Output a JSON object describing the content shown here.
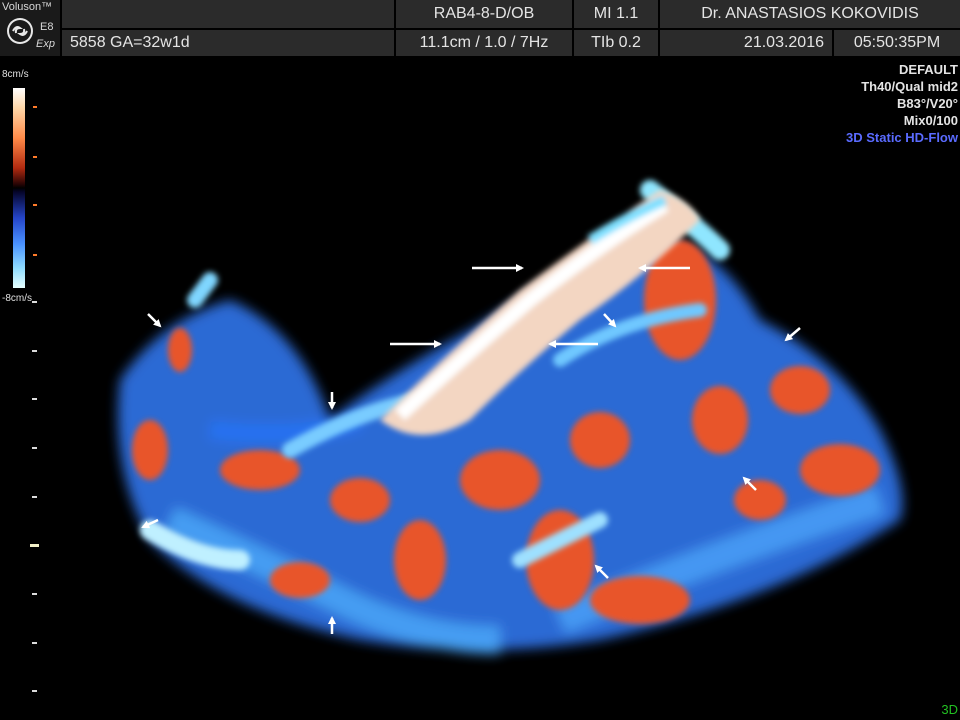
{
  "header": {
    "brand": "Voluson™",
    "model": "E8",
    "mode": "Exp",
    "probe": "RAB4-8-D/OB",
    "mi": "MI  1.1",
    "doctor": "Dr. ANASTASIOS KOKOVIDIS",
    "patient": "5858  GA=32w1d",
    "depth": "11.1cm / 1.0 /  7Hz",
    "tib": "TIb  0.2",
    "date": "21.03.2016",
    "time": "05:50:35PM"
  },
  "colorbar": {
    "top_label": "8cm/s",
    "bottom_label": "-8cm/s"
  },
  "info": {
    "preset": "DEFAULT",
    "threshold": "Th40/Qual mid2",
    "angle": "B83°/V20°",
    "mix": "Mix0/100",
    "mode": "3D Static HD-Flow",
    "view_tag": "3D"
  },
  "colors": {
    "header_bg": "#2b2b2b",
    "flow_red": "#ff6a3a",
    "flow_blue": "#3a8cff",
    "flow_cyan": "#8fe6ff",
    "mode_text": "#5a6bff",
    "view_tag": "#22c022"
  },
  "icons": [
    "ge-logo-icon",
    "arrow-icon"
  ]
}
